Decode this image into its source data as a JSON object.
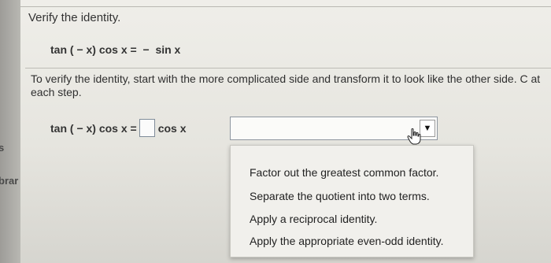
{
  "sidebar": {
    "labels": [
      "s",
      "brar"
    ]
  },
  "problem": {
    "title": "Verify the identity.",
    "identity": "tan ( − x) cos x =  −  sin x",
    "instructions": "To verify the identity, start with the more complicated side and transform it to look like the other side. C at each step."
  },
  "equation": {
    "left": "tan ( − x) cos x =",
    "right": "cos x",
    "box_value": ""
  },
  "dropdown": {
    "selected": "",
    "arrow_glyph": "▼",
    "options": [
      "Factor out the greatest common factor.",
      "Separate the quotient into two terms.",
      "Apply a reciprocal identity.",
      "Apply the appropriate even-odd identity."
    ]
  }
}
